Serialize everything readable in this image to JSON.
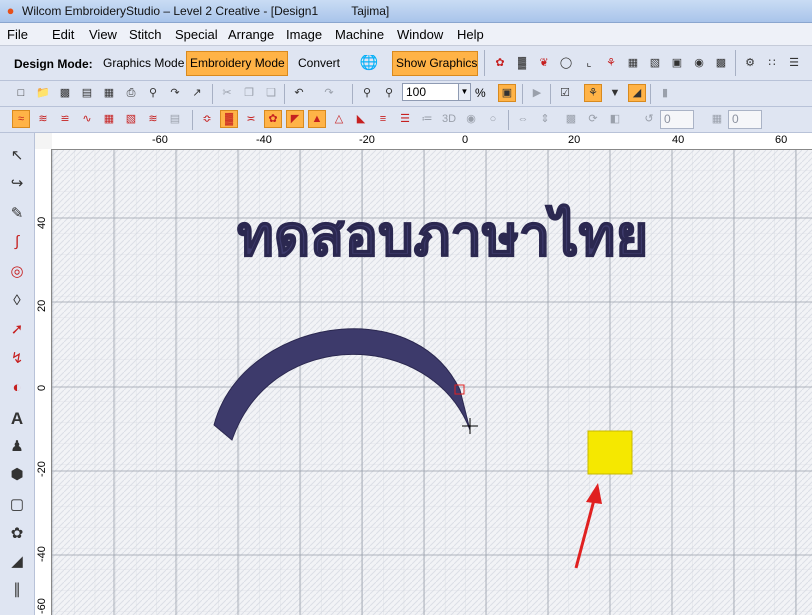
{
  "window": {
    "title": "Wilcom EmbroideryStudio – Level 2 Creative - [Design1          Tajima]"
  },
  "menu": [
    "File",
    "Edit",
    "View",
    "Stitch",
    "Special",
    "Arrange",
    "Image",
    "Machine",
    "Window",
    "Help"
  ],
  "mode_toolbar": {
    "label": "Design Mode:",
    "graphics_mode": "Graphics Mode",
    "embroidery_mode": "Embroidery Mode",
    "convert": "Convert",
    "show_graphics": "Show Graphics",
    "active_mode": "Embroidery Mode"
  },
  "zoom": {
    "value": "100",
    "unit": "%"
  },
  "rotate_inputs": {
    "angle": "0",
    "skew": "0"
  },
  "rulers": {
    "top": [
      "-60",
      "-40",
      "-20",
      "0",
      "20",
      "40",
      "60"
    ],
    "left": [
      "40",
      "20",
      "0",
      "-20",
      "-40",
      "-60"
    ]
  },
  "design": {
    "thai_text": "ทดสอบภาษาไทย",
    "thread_color": "#3d3a6b",
    "swatch_color": "#f5e800",
    "arrow_color": "#e02020"
  },
  "icons": {
    "app": "wilcom-app-icon",
    "left_tools": [
      "select-object-icon",
      "reshape-object-icon",
      "knife-icon",
      "stitch-effect-icon",
      "travel-icon",
      "node-edit-icon",
      "run-line-icon",
      "column-line-icon",
      "arc-shape-icon",
      "lettering-icon",
      "team-names-icon",
      "monogram-icon",
      "appliqué-icon",
      "color-wheel-icon",
      "two-sided-icon",
      "align-icon"
    ]
  }
}
